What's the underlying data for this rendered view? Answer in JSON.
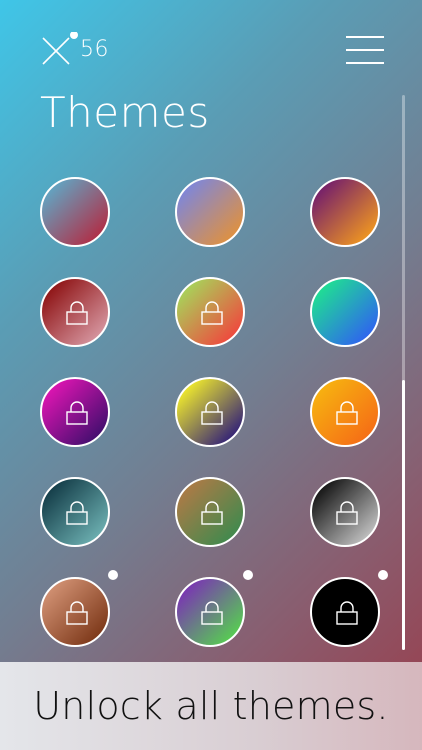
{
  "header": {
    "count": "56",
    "logo_icon": "x-logo-icon",
    "menu_icon": "hamburger-menu-icon"
  },
  "title": "Themes",
  "themes": [
    {
      "colors": [
        "#5fa9c7",
        "#b32a42"
      ],
      "locked": false,
      "is_new": false
    },
    {
      "colors": [
        "#7a86e0",
        "#e3913a"
      ],
      "locked": false,
      "is_new": false
    },
    {
      "colors": [
        "#6f1a6e",
        "#f39a1f"
      ],
      "locked": false,
      "is_new": false
    },
    {
      "colors": [
        "#8c0f10",
        "#d89aa4"
      ],
      "locked": true,
      "is_new": false
    },
    {
      "colors": [
        "#a5d85b",
        "#f2433d"
      ],
      "locked": true,
      "is_new": false
    },
    {
      "colors": [
        "#1fe48f",
        "#2f5ff2"
      ],
      "locked": false,
      "is_new": false
    },
    {
      "colors": [
        "#e315b4",
        "#3d0e6c"
      ],
      "locked": true,
      "is_new": false
    },
    {
      "colors": [
        "#f6f12a",
        "#2c1a7a"
      ],
      "locked": true,
      "is_new": false
    },
    {
      "colors": [
        "#f7b410",
        "#f56b16"
      ],
      "locked": true,
      "is_new": false
    },
    {
      "colors": [
        "#103844",
        "#6fb3b4"
      ],
      "locked": true,
      "is_new": false
    },
    {
      "colors": [
        "#b07a46",
        "#3c8a4e"
      ],
      "locked": true,
      "is_new": false
    },
    {
      "colors": [
        "#0e0e0e",
        "#c7c7c7"
      ],
      "locked": true,
      "is_new": false
    },
    {
      "colors": [
        "#d49476",
        "#7a3516"
      ],
      "locked": true,
      "is_new": true
    },
    {
      "colors": [
        "#7b2fb7",
        "#56d34e"
      ],
      "locked": true,
      "is_new": true
    },
    {
      "colors": [
        "#000000",
        "#000000"
      ],
      "locked": true,
      "is_new": true
    }
  ],
  "banner": {
    "label": "Unlock all themes."
  }
}
